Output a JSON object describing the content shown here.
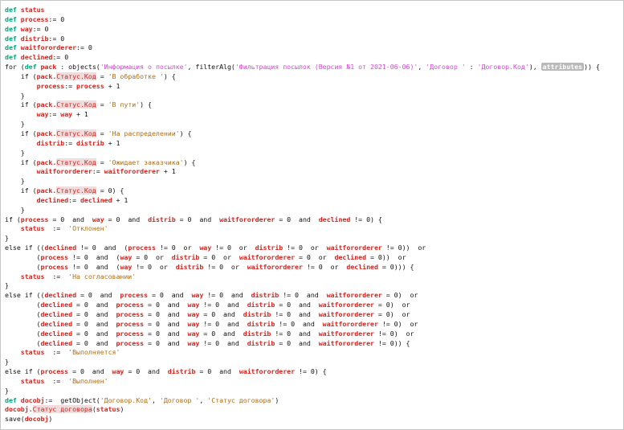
{
  "editor": {
    "lines": [
      [
        [
          "kw",
          "def"
        ],
        [
          "txt",
          " "
        ],
        [
          "v",
          "status"
        ]
      ],
      [
        [
          "kw",
          "def"
        ],
        [
          "txt",
          " "
        ],
        [
          "v",
          "process"
        ],
        [
          "op",
          ":= 0"
        ]
      ],
      [
        [
          "kw",
          "def"
        ],
        [
          "txt",
          " "
        ],
        [
          "v",
          "way"
        ],
        [
          "op",
          ":= 0"
        ]
      ],
      [
        [
          "kw",
          "def"
        ],
        [
          "txt",
          " "
        ],
        [
          "v",
          "distrib"
        ],
        [
          "op",
          ":= 0"
        ]
      ],
      [
        [
          "kw",
          "def"
        ],
        [
          "txt",
          " "
        ],
        [
          "v",
          "waitfororderer"
        ],
        [
          "op",
          ":= 0"
        ]
      ],
      [
        [
          "kw",
          "def"
        ],
        [
          "txt",
          " "
        ],
        [
          "v",
          "declined"
        ],
        [
          "op",
          ":= 0"
        ]
      ],
      [
        [
          "txt",
          "for ("
        ],
        [
          "kw",
          "def"
        ],
        [
          "txt",
          " "
        ],
        [
          "v",
          "pack"
        ],
        [
          "txt",
          " : objects("
        ],
        [
          "s2",
          "'Информация о посылке'"
        ],
        [
          "txt",
          ", filterAlg("
        ],
        [
          "s2",
          "'Фильтрация посылок (Версия №1 от 2021-06-06)'"
        ],
        [
          "txt",
          ", "
        ],
        [
          "s2",
          "'Договор '"
        ],
        [
          "txt",
          " : "
        ],
        [
          "s2",
          "'Договор.Код'"
        ],
        [
          "txt",
          "), "
        ],
        [
          "tag",
          "attributes"
        ],
        [
          "txt",
          ")) {"
        ]
      ],
      [
        [
          "txt",
          "    if ("
        ],
        [
          "v",
          "pack."
        ],
        [
          "bx",
          "Статус.Код"
        ],
        [
          "txt",
          " = "
        ],
        [
          "s",
          "'В обработке '"
        ],
        [
          "txt",
          ") {"
        ]
      ],
      [
        [
          "txt",
          "        "
        ],
        [
          "v",
          "process"
        ],
        [
          "op",
          ":= "
        ],
        [
          "v",
          "process"
        ],
        [
          "op",
          " + 1"
        ]
      ],
      [
        [
          "txt",
          "    }"
        ]
      ],
      [
        [
          "txt",
          "    if ("
        ],
        [
          "v",
          "pack."
        ],
        [
          "bx",
          "Статус.Код"
        ],
        [
          "txt",
          " = "
        ],
        [
          "s",
          "'В пути'"
        ],
        [
          "txt",
          ") {"
        ]
      ],
      [
        [
          "txt",
          "        "
        ],
        [
          "v",
          "way"
        ],
        [
          "op",
          ":= "
        ],
        [
          "v",
          "way"
        ],
        [
          "op",
          " + 1"
        ]
      ],
      [
        [
          "txt",
          "    }"
        ]
      ],
      [
        [
          "txt",
          "    if ("
        ],
        [
          "v",
          "pack."
        ],
        [
          "bx",
          "Статус.Код"
        ],
        [
          "txt",
          " = "
        ],
        [
          "s",
          "'На распределении'"
        ],
        [
          "txt",
          ") {"
        ]
      ],
      [
        [
          "txt",
          "        "
        ],
        [
          "v",
          "distrib"
        ],
        [
          "op",
          ":= "
        ],
        [
          "v",
          "distrib"
        ],
        [
          "op",
          " + 1"
        ]
      ],
      [
        [
          "txt",
          "    }"
        ]
      ],
      [
        [
          "txt",
          "    if ("
        ],
        [
          "v",
          "pack."
        ],
        [
          "bx",
          "Статус.Код"
        ],
        [
          "txt",
          " = "
        ],
        [
          "s",
          "'Ожидает заказчика'"
        ],
        [
          "txt",
          ") {"
        ]
      ],
      [
        [
          "txt",
          "        "
        ],
        [
          "v",
          "waitfororderer"
        ],
        [
          "op",
          ":= "
        ],
        [
          "v",
          "waitfororderer"
        ],
        [
          "op",
          " + 1"
        ]
      ],
      [
        [
          "txt",
          "    }"
        ]
      ],
      [
        [
          "txt",
          "    if ("
        ],
        [
          "v",
          "pack."
        ],
        [
          "bx",
          "Статус.Код"
        ],
        [
          "txt",
          " = 0) {"
        ]
      ],
      [
        [
          "txt",
          "        "
        ],
        [
          "v",
          "declined"
        ],
        [
          "op",
          ":= "
        ],
        [
          "v",
          "declined"
        ],
        [
          "op",
          " + 1"
        ]
      ],
      [
        [
          "txt",
          "    }"
        ]
      ],
      [
        [
          "txt",
          "if ("
        ],
        [
          "v",
          "process"
        ],
        [
          "txt",
          " = 0  and  "
        ],
        [
          "v",
          "way"
        ],
        [
          "txt",
          " = 0  and  "
        ],
        [
          "v",
          "distrib"
        ],
        [
          "txt",
          " = 0  and  "
        ],
        [
          "v",
          "waitfororderer"
        ],
        [
          "txt",
          " = 0  and  "
        ],
        [
          "v",
          "declined"
        ],
        [
          "txt",
          " != 0) {"
        ]
      ],
      [
        [
          "txt",
          "    "
        ],
        [
          "v",
          "status"
        ],
        [
          "txt",
          "  :=  "
        ],
        [
          "s",
          "'Отклонен'"
        ]
      ],
      [
        [
          "txt",
          "}"
        ]
      ],
      [
        [
          "txt",
          "else if (("
        ],
        [
          "v",
          "declined"
        ],
        [
          "txt",
          " != 0  and  ("
        ],
        [
          "v",
          "process"
        ],
        [
          "txt",
          " != 0  or  "
        ],
        [
          "v",
          "way"
        ],
        [
          "txt",
          " != 0  or  "
        ],
        [
          "v",
          "distrib"
        ],
        [
          "txt",
          " != 0  or  "
        ],
        [
          "v",
          "waitfororderer"
        ],
        [
          "txt",
          " != 0))  or"
        ]
      ],
      [
        [
          "txt",
          "        ("
        ],
        [
          "v",
          "process"
        ],
        [
          "txt",
          " != 0  and  ("
        ],
        [
          "v",
          "way"
        ],
        [
          "txt",
          " = 0  or  "
        ],
        [
          "v",
          "distrib"
        ],
        [
          "txt",
          " = 0  or  "
        ],
        [
          "v",
          "waitfororderer"
        ],
        [
          "txt",
          " = 0  or  "
        ],
        [
          "v",
          "declined"
        ],
        [
          "txt",
          " = 0))  or"
        ]
      ],
      [
        [
          "txt",
          "        ("
        ],
        [
          "v",
          "process"
        ],
        [
          "txt",
          " != 0  and  ("
        ],
        [
          "v",
          "way"
        ],
        [
          "txt",
          " != 0  or  "
        ],
        [
          "v",
          "distrib"
        ],
        [
          "txt",
          " != 0  or  "
        ],
        [
          "v",
          "waitfororderer"
        ],
        [
          "txt",
          " != 0  or  "
        ],
        [
          "v",
          "declined"
        ],
        [
          "txt",
          " = 0))) {"
        ]
      ],
      [
        [
          "txt",
          "    "
        ],
        [
          "v",
          "status"
        ],
        [
          "txt",
          "  :=  "
        ],
        [
          "s",
          "'На согласовании'"
        ]
      ],
      [
        [
          "txt",
          "}"
        ]
      ],
      [
        [
          "txt",
          "else if (("
        ],
        [
          "v",
          "declined"
        ],
        [
          "txt",
          " = 0  and  "
        ],
        [
          "v",
          "process"
        ],
        [
          "txt",
          " = 0  and  "
        ],
        [
          "v",
          "way"
        ],
        [
          "txt",
          " != 0  and  "
        ],
        [
          "v",
          "distrib"
        ],
        [
          "txt",
          " != 0  and  "
        ],
        [
          "v",
          "waitfororderer"
        ],
        [
          "txt",
          " = 0)  or"
        ]
      ],
      [
        [
          "txt",
          "        ("
        ],
        [
          "v",
          "declined"
        ],
        [
          "txt",
          " = 0  and  "
        ],
        [
          "v",
          "process"
        ],
        [
          "txt",
          " = 0  and  "
        ],
        [
          "v",
          "way"
        ],
        [
          "txt",
          " != 0  and  "
        ],
        [
          "v",
          "distrib"
        ],
        [
          "txt",
          " = 0  and  "
        ],
        [
          "v",
          "waitfororderer"
        ],
        [
          "txt",
          " = 0)  or"
        ]
      ],
      [
        [
          "txt",
          "        ("
        ],
        [
          "v",
          "declined"
        ],
        [
          "txt",
          " = 0  and  "
        ],
        [
          "v",
          "process"
        ],
        [
          "txt",
          " = 0  and  "
        ],
        [
          "v",
          "way"
        ],
        [
          "txt",
          " = 0  and  "
        ],
        [
          "v",
          "distrib"
        ],
        [
          "txt",
          " != 0  and  "
        ],
        [
          "v",
          "waitfororderer"
        ],
        [
          "txt",
          " = 0)  or"
        ]
      ],
      [
        [
          "txt",
          "        ("
        ],
        [
          "v",
          "declined"
        ],
        [
          "txt",
          " = 0  and  "
        ],
        [
          "v",
          "process"
        ],
        [
          "txt",
          " = 0  and  "
        ],
        [
          "v",
          "way"
        ],
        [
          "txt",
          " != 0  and  "
        ],
        [
          "v",
          "distrib"
        ],
        [
          "txt",
          " != 0  and  "
        ],
        [
          "v",
          "waitfororderer"
        ],
        [
          "txt",
          " != 0)  or"
        ]
      ],
      [
        [
          "txt",
          "        ("
        ],
        [
          "v",
          "declined"
        ],
        [
          "txt",
          " = 0  and  "
        ],
        [
          "v",
          "process"
        ],
        [
          "txt",
          " = 0  and  "
        ],
        [
          "v",
          "way"
        ],
        [
          "txt",
          " = 0  and  "
        ],
        [
          "v",
          "distrib"
        ],
        [
          "txt",
          " != 0  and  "
        ],
        [
          "v",
          "waitfororderer"
        ],
        [
          "txt",
          " != 0)  or"
        ]
      ],
      [
        [
          "txt",
          "        ("
        ],
        [
          "v",
          "declined"
        ],
        [
          "txt",
          " = 0  and  "
        ],
        [
          "v",
          "process"
        ],
        [
          "txt",
          " = 0  and  "
        ],
        [
          "v",
          "way"
        ],
        [
          "txt",
          " != 0  and  "
        ],
        [
          "v",
          "distrib"
        ],
        [
          "txt",
          " = 0  and  "
        ],
        [
          "v",
          "waitfororderer"
        ],
        [
          "txt",
          " != 0)) {"
        ]
      ],
      [
        [
          "txt",
          "    "
        ],
        [
          "v",
          "status"
        ],
        [
          "txt",
          "  :=  "
        ],
        [
          "s",
          "'Выполняется'"
        ]
      ],
      [
        [
          "txt",
          "}"
        ]
      ],
      [
        [
          "txt",
          "else if ("
        ],
        [
          "v",
          "process"
        ],
        [
          "txt",
          " = 0  and  "
        ],
        [
          "v",
          "way"
        ],
        [
          "txt",
          " = 0  and  "
        ],
        [
          "v",
          "distrib"
        ],
        [
          "txt",
          " = 0  and  "
        ],
        [
          "v",
          "waitfororderer"
        ],
        [
          "txt",
          " != 0) {"
        ]
      ],
      [
        [
          "txt",
          "    "
        ],
        [
          "v",
          "status"
        ],
        [
          "txt",
          "  :=  "
        ],
        [
          "s",
          "'Выполнен'"
        ]
      ],
      [
        [
          "txt",
          "}"
        ]
      ],
      [
        [
          "kw",
          "def"
        ],
        [
          "txt",
          " "
        ],
        [
          "v",
          "docobj"
        ],
        [
          "op",
          ":= "
        ],
        [
          "txt",
          " getObject("
        ],
        [
          "s",
          "'Договор.Код'"
        ],
        [
          "txt",
          ", "
        ],
        [
          "s",
          "'Договор '"
        ],
        [
          "txt",
          ", "
        ],
        [
          "s",
          "'Статус договора'"
        ],
        [
          "txt",
          ")"
        ]
      ],
      [
        [
          "v",
          "docobj."
        ],
        [
          "bx",
          "Статус договора"
        ],
        [
          "txt",
          "("
        ],
        [
          "v",
          "status"
        ],
        [
          "txt",
          ")"
        ]
      ],
      [
        [
          "txt",
          "save("
        ],
        [
          "v",
          "docobj"
        ],
        [
          "txt",
          ")"
        ]
      ]
    ]
  }
}
